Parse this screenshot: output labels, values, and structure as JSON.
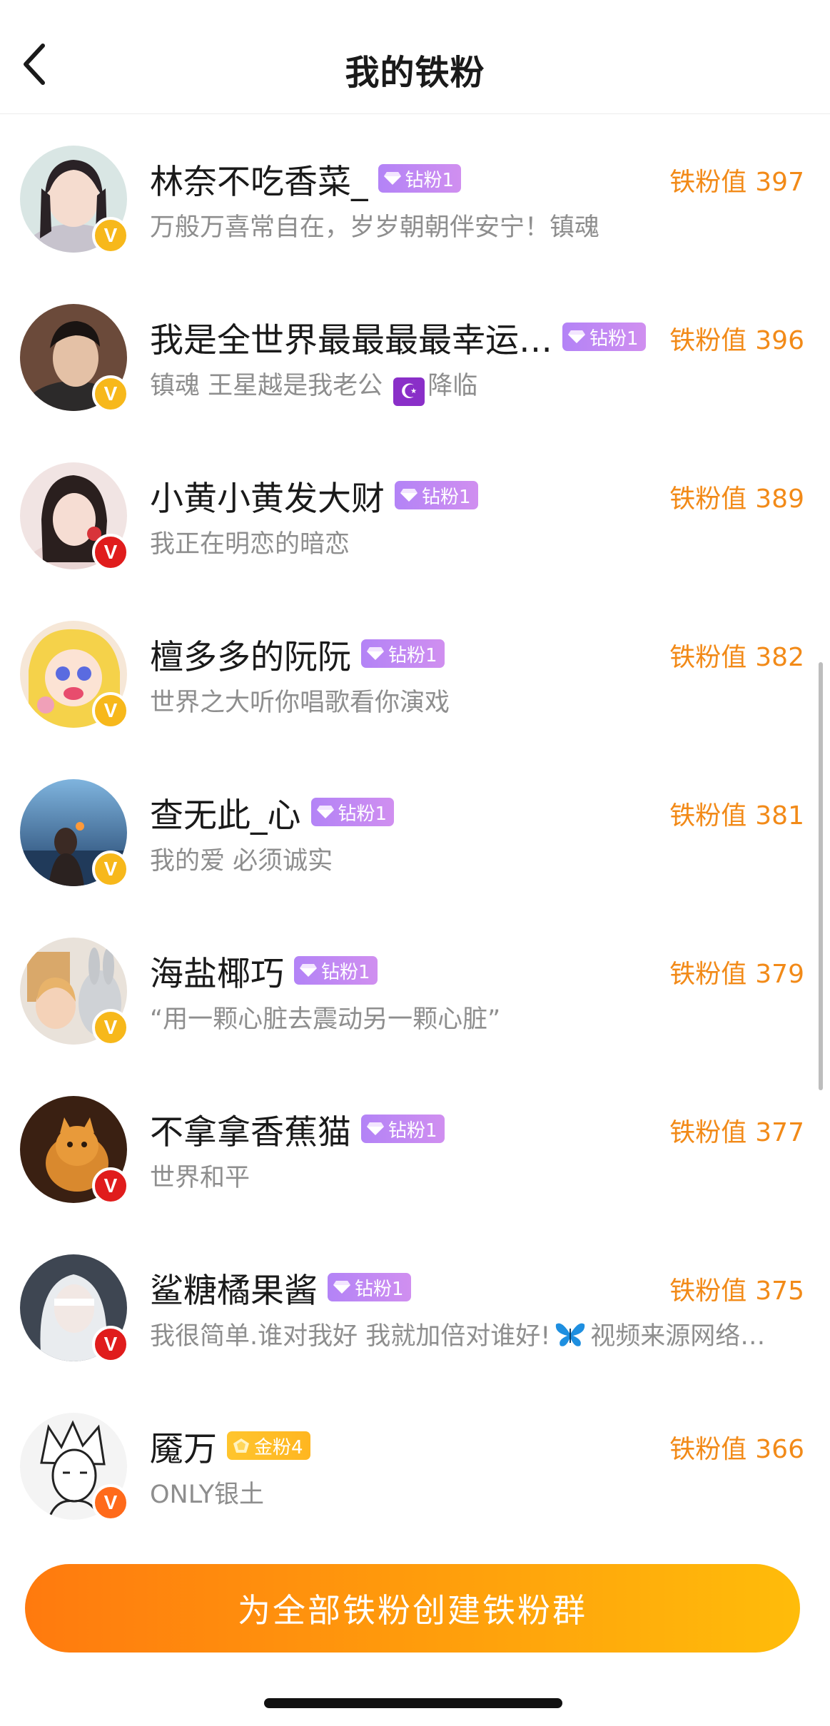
{
  "header": {
    "title": "我的铁粉",
    "back_icon": "chevron-left-icon"
  },
  "score_label": "铁粉值",
  "colors": {
    "accent": "#f28a18",
    "diamond_badge": "#c088f3",
    "gold_badge": "#ffc22a",
    "verify_gold": "#f7b81b",
    "verify_red": "#e01c1c",
    "verify_orange": "#ff6a1a"
  },
  "fans": [
    {
      "name": "林奈不吃香菜_",
      "badge": "钻粉1",
      "badge_type": "diamond",
      "score": "397",
      "bio": "万般万喜常自在，岁岁朝朝伴安宁！镇魂",
      "verify": "gold"
    },
    {
      "name": "我是全世界最最最最幸运…",
      "badge": "钻粉1",
      "badge_type": "diamond",
      "score": "396",
      "bio_before": "镇魂 王星越是我老公",
      "bio_emoji": "☪",
      "bio_after": "降临",
      "verify": "gold"
    },
    {
      "name": "小黄小黄发大财",
      "badge": "钻粉1",
      "badge_type": "diamond",
      "score": "389",
      "bio": "我正在明恋的暗恋",
      "verify": "red"
    },
    {
      "name": "檀多多的阮阮",
      "badge": "钻粉1",
      "badge_type": "diamond",
      "score": "382",
      "bio": "世界之大听你唱歌看你演戏",
      "verify": "gold"
    },
    {
      "name": "查无此_心",
      "badge": "钻粉1",
      "badge_type": "diamond",
      "score": "381",
      "bio": "我的爱 必须诚实",
      "verify": "gold"
    },
    {
      "name": "海盐椰巧",
      "badge": "钻粉1",
      "badge_type": "diamond",
      "score": "379",
      "bio": "“用一颗心脏去震动另一颗心脏”",
      "verify": "gold"
    },
    {
      "name": "不拿拿香蕉猫",
      "badge": "钻粉1",
      "badge_type": "diamond",
      "score": "377",
      "bio": "世界和平",
      "verify": "red"
    },
    {
      "name": "鲨糖橘果酱",
      "badge": "钻粉1",
      "badge_type": "diamond",
      "score": "375",
      "bio_before": "我很简单.谁对我好 我就加倍对谁好!",
      "bio_emoji": "butterfly-icon",
      "bio_after": "视频来源网络…",
      "verify": "red"
    },
    {
      "name": "魇万",
      "badge": "金粉4",
      "badge_type": "gold",
      "score": "366",
      "bio": "ONLY银土",
      "verify": "orange"
    }
  ],
  "cta": {
    "label": "为全部铁粉创建铁粉群"
  }
}
